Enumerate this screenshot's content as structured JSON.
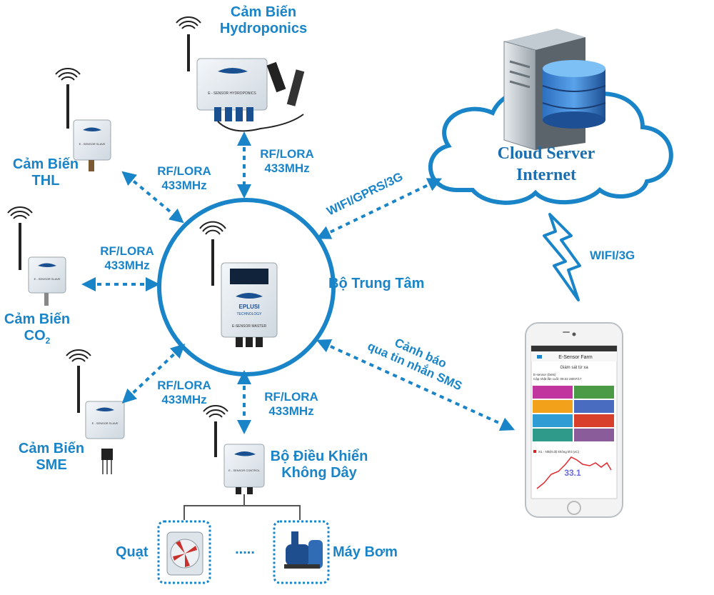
{
  "sensors": {
    "hydroponics": {
      "line1": "Cảm Biến",
      "line2": "Hydroponics",
      "device_label": "E - SENSOR HYDROPONICS"
    },
    "thl": {
      "line1": "Cảm Biến",
      "line2": "THL",
      "device_label": "E - SENSOR SLAVE"
    },
    "co2": {
      "line1": "Cảm Biến",
      "line2": "CO",
      "sub": "2",
      "device_label": "E - SENSOR SLAVE"
    },
    "sme": {
      "line1": "Cảm Biến",
      "line2": "SME",
      "device_label": "E - SENSOR SLAVE"
    }
  },
  "links": {
    "thl": {
      "l1": "RF/LORA",
      "l2": "433MHz"
    },
    "hydro": {
      "l1": "RF/LORA",
      "l2": "433MHz"
    },
    "co2": {
      "l1": "RF/LORA",
      "l2": "433MHz"
    },
    "sme": {
      "l1": "RF/LORA",
      "l2": "433MHz"
    },
    "control": {
      "l1": "RF/LORA",
      "l2": "433MHz"
    },
    "cloud": "WIFI/GPRS/3G",
    "phone": "WIFI/3G",
    "sms_l1": "Cảnh báo",
    "sms_l2": "qua tin nhắn SMS"
  },
  "center": {
    "label": "Bộ Trung Tâm",
    "brand": "EPLUSI",
    "brand_sub": "TECHNOLOGY",
    "device_label": "E-SENSOR MASTER"
  },
  "cloud": {
    "line1": "Cloud Server",
    "line2": "Internet"
  },
  "controller": {
    "line1": "Bộ Điều Khiển",
    "line2": "Không Dây",
    "device_label": "E - SENSOR CONTROL"
  },
  "actuators": {
    "fan": "Quạt",
    "dots": ".....",
    "pump": "Máy Bơm"
  },
  "phone": {
    "app_title": "E-Sensor Farm",
    "subtitle": "Giám sát từ xa",
    "device_name": "E-sensor (Dets)",
    "updated": "Cập nhật lần cuối: 09:22 28/07/17",
    "chart_title": "S1 - Nhiệt độ không khí (oC)",
    "chart_value": "33.1"
  },
  "colors": {
    "accent": "#1a84c8",
    "cloud_fill": "#ffffff",
    "cloud_stroke": "#1a84c8"
  }
}
